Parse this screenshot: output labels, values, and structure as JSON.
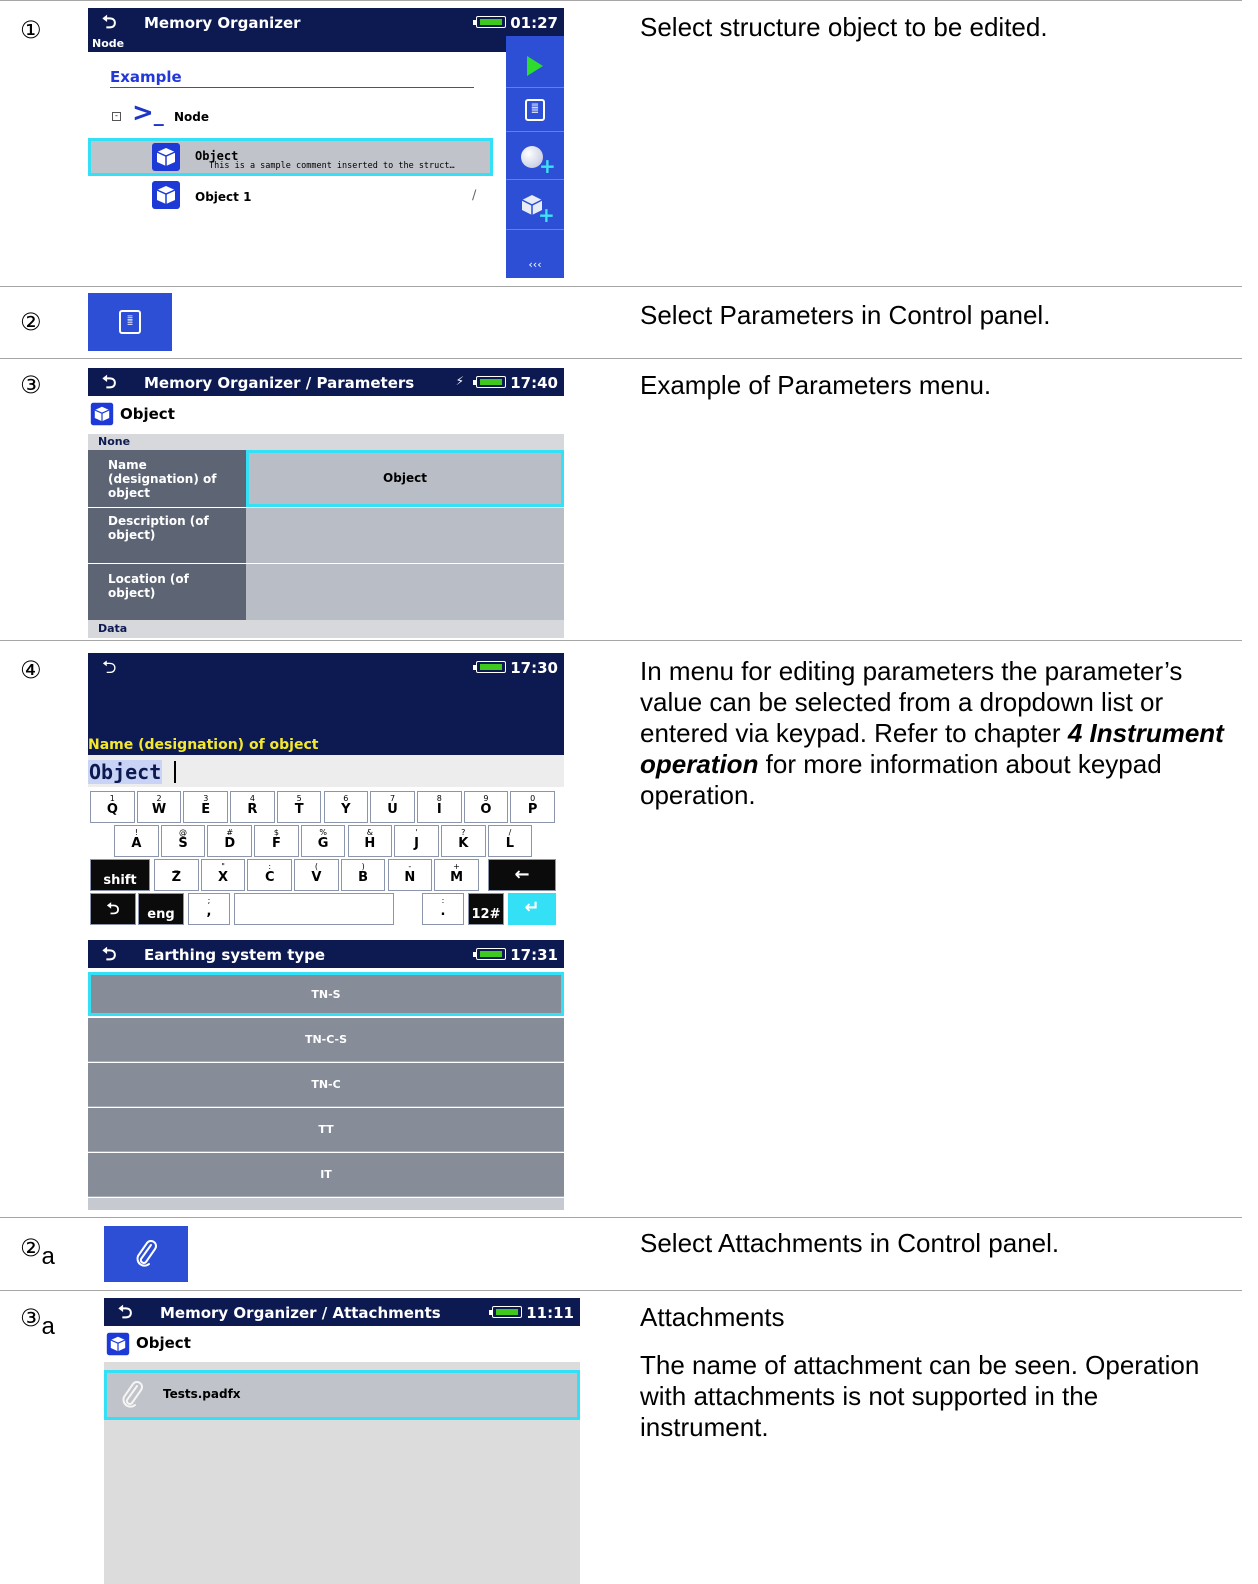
{
  "rows": {
    "r1": {
      "marker": "①",
      "description": "Select structure object to be edited.",
      "screen": {
        "title": "Memory Organizer",
        "time": "01:27",
        "subheader": "Node",
        "header": "Example",
        "tree_node": "Node",
        "object_name": "Object",
        "object_comment": "This is a sample comment inserted to the struct…",
        "object1_name": "Object 1",
        "more_label": "‹‹‹"
      }
    },
    "r2": {
      "marker": "②",
      "description": "Select Parameters in Control panel."
    },
    "r3": {
      "marker": "③",
      "description": "Example of Parameters menu.",
      "screen": {
        "title": "Memory Organizer / Parameters",
        "time": "17:40",
        "object": "Object",
        "group_none": "None",
        "params": [
          {
            "label": "Name (designation) of object",
            "value": "Object"
          },
          {
            "label": "Description (of object)",
            "value": ""
          },
          {
            "label": "Location (of object)",
            "value": ""
          }
        ],
        "group_data": "Data"
      }
    },
    "r4": {
      "marker": "④",
      "description_pre": "In menu for editing parameters the parameter’s value can be selected from a dropdown list or entered via keypad. Refer to chapter ",
      "description_bold": "4 Instrument operation",
      "description_post": " for more information about keypad operation.",
      "keypad": {
        "time": "17:30",
        "field_label": "Name (designation) of object",
        "field_value": "Object",
        "row1": [
          [
            "1",
            "Q"
          ],
          [
            "2",
            "W"
          ],
          [
            "3",
            "E"
          ],
          [
            "4",
            "R"
          ],
          [
            "5",
            "T"
          ],
          [
            "6",
            "Y"
          ],
          [
            "7",
            "U"
          ],
          [
            "8",
            "I"
          ],
          [
            "9",
            "O"
          ],
          [
            "0",
            "P"
          ]
        ],
        "row2": [
          [
            "!",
            "A"
          ],
          [
            "@",
            "S"
          ],
          [
            "#",
            "D"
          ],
          [
            "$",
            "F"
          ],
          [
            "%",
            "G"
          ],
          [
            "&",
            "H"
          ],
          [
            "'",
            "J"
          ],
          [
            "?",
            "K"
          ],
          [
            "/",
            "L"
          ]
        ],
        "row3": [
          [
            "_",
            "Z"
          ],
          [
            "\"",
            "X"
          ],
          [
            ":",
            "C"
          ],
          [
            "(",
            "V"
          ],
          [
            ")",
            "B"
          ],
          [
            "-",
            "N"
          ],
          [
            "+",
            "M"
          ]
        ],
        "shift": "shift",
        "lang": "eng",
        "comma_top": ";",
        "comma": ",",
        "dot_top": ":",
        "dot": ".",
        "num": "12#",
        "backspace": "←",
        "enter": "↵"
      },
      "list": {
        "title": "Earthing system type",
        "time": "17:31",
        "options": [
          "TN-S",
          "TN-C-S",
          "TN-C",
          "TT",
          "IT"
        ]
      }
    },
    "r2a": {
      "marker": "②",
      "marker_sub": "a",
      "description": "Select Attachments in Control panel."
    },
    "r3a": {
      "marker": "③",
      "marker_sub": "a",
      "description_1": "Attachments",
      "description_2": "The name of attachment can be seen. Operation with attachments is not supported in the instrument.",
      "screen": {
        "title": "Memory Organizer / Attachments",
        "time": "11:11",
        "object": "Object",
        "attachment": "Tests.padfx"
      }
    }
  },
  "colors": {
    "title_bar": "#0d1a52",
    "control_panel": "#2d4fd6",
    "highlight": "#33e0f5",
    "param_label": "#5d6574",
    "param_value": "#b9bdc6"
  },
  "icons": [
    "back-arrow-icon",
    "battery-icon",
    "play-icon",
    "parameters-icon",
    "add-node-icon",
    "add-object-icon",
    "object-icon",
    "node-icon",
    "paperclip-icon",
    "collapse-icon"
  ]
}
